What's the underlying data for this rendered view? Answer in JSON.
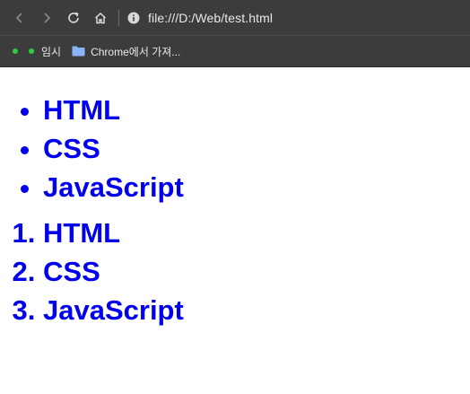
{
  "browser": {
    "url": "file:///D:/Web/test.html",
    "bookmarks": [
      {
        "label": ""
      },
      {
        "label": "임시"
      },
      {
        "label": "Chrome에서 가져..."
      }
    ]
  },
  "content": {
    "unordered_list": [
      "HTML",
      "CSS",
      "JavaScript"
    ],
    "ordered_list": [
      "HTML",
      "CSS",
      "JavaScript"
    ]
  },
  "colors": {
    "text": "#0000ee",
    "chrome_bg": "#3c3c3c",
    "bookmark_dot": "#2ecc40"
  }
}
